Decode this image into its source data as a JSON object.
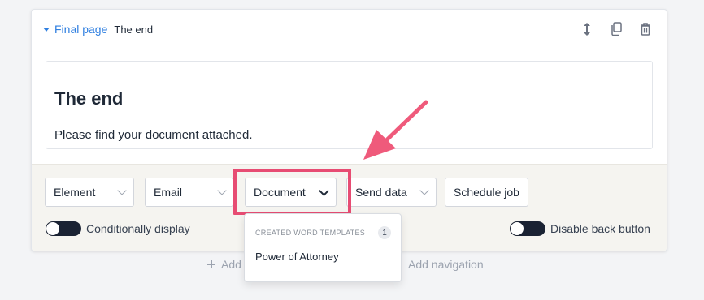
{
  "card": {
    "page_type": "Final page",
    "page_name": "The end",
    "icons": [
      "reorder-icon",
      "duplicate-icon",
      "trash-icon"
    ]
  },
  "preview": {
    "title": "The end",
    "body": "Please find your document attached."
  },
  "footer": {
    "selects": [
      {
        "label": "Element"
      },
      {
        "label": "Email"
      },
      {
        "label": "Document"
      },
      {
        "label": "Send data"
      }
    ],
    "schedule_button": "Schedule job",
    "toggle_left": "Conditionally display",
    "toggle_right": "Disable back button"
  },
  "dropdown": {
    "section_label": "CREATED WORD TEMPLATES",
    "count": "1",
    "items": [
      "Power of Attorney"
    ]
  },
  "bottom": {
    "add_left": "Add",
    "add_navigation": "Add navigation"
  },
  "colors": {
    "accent": "#2f7fe0",
    "highlight": "#e74c73",
    "toggle": "#1a2233"
  }
}
